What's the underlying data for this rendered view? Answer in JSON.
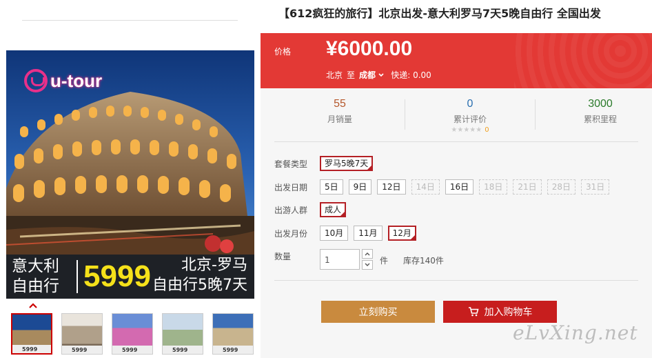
{
  "product": {
    "title": "【612疯狂的旅行】北京出发-意大利罗马7天5晚自由行 全国出发"
  },
  "gallery": {
    "brand": "u-tour",
    "banner": {
      "destination_line1": "意大利",
      "destination_line2": "自由行",
      "price": "5999",
      "route_line1": "北京-罗马",
      "route_line2": "自由行5晚7天"
    },
    "thumb_prices": [
      "5999",
      "5999",
      "5999",
      "5999",
      "5999"
    ]
  },
  "price_panel": {
    "label": "价格",
    "price": "¥6000.00",
    "from_city": "北京",
    "to_word": "至",
    "to_city": "成都",
    "shipping": "快递: 0.00"
  },
  "stats": {
    "monthly_sales": {
      "value": "55",
      "label": "月销量"
    },
    "reviews": {
      "value": "0",
      "label": "累计评价",
      "stars": "★★★★★",
      "score": "0"
    },
    "mileage": {
      "value": "3000",
      "label": "累积里程"
    }
  },
  "options": {
    "package": {
      "label": "套餐类型",
      "items": [
        {
          "text": "罗马5晚7天",
          "state": "selected"
        }
      ]
    },
    "departure_date": {
      "label": "出发日期",
      "items": [
        {
          "text": "5日",
          "state": "normal"
        },
        {
          "text": "9日",
          "state": "normal"
        },
        {
          "text": "12日",
          "state": "normal"
        },
        {
          "text": "14日",
          "state": "disabled"
        },
        {
          "text": "16日",
          "state": "normal"
        },
        {
          "text": "18日",
          "state": "disabled"
        },
        {
          "text": "21日",
          "state": "disabled"
        },
        {
          "text": "28日",
          "state": "disabled"
        },
        {
          "text": "31日",
          "state": "disabled"
        }
      ]
    },
    "travelers": {
      "label": "出游人群",
      "items": [
        {
          "text": "成人",
          "state": "selected"
        }
      ]
    },
    "departure_month": {
      "label": "出发月份",
      "items": [
        {
          "text": "10月",
          "state": "normal"
        },
        {
          "text": "11月",
          "state": "normal"
        },
        {
          "text": "12月",
          "state": "selected"
        }
      ]
    }
  },
  "quantity": {
    "label": "数量",
    "value": "1",
    "unit": "件",
    "stock": "库存140件"
  },
  "actions": {
    "buy_now": "立刻购买",
    "add_to_cart": "加入购物车"
  },
  "watermark": "eLvXing.net",
  "colors": {
    "price_bg": "#e33935",
    "buy_btn": "#c98a3e",
    "cart_btn": "#c71e1e",
    "selected_border": "#b41f24",
    "sales_color": "#b5582c",
    "review_color": "#2a6fb0",
    "mileage_color": "#2a7a2a"
  }
}
